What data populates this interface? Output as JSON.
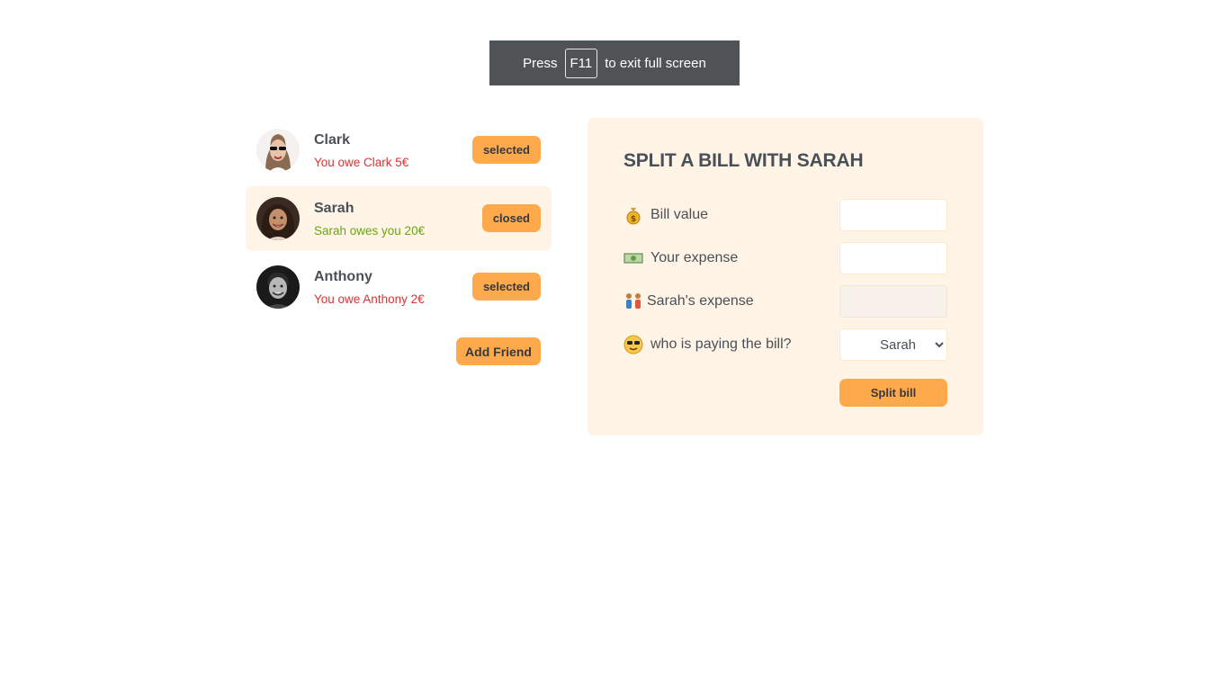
{
  "toast": {
    "press": "Press",
    "key": "F11",
    "suffix": "to exit full screen"
  },
  "friends": [
    {
      "name": "Clark",
      "balance": "You owe Clark 5€",
      "status": "red",
      "button": "selected"
    },
    {
      "name": "Sarah",
      "balance": "Sarah owes you 20€",
      "status": "green",
      "button": "closed"
    },
    {
      "name": "Anthony",
      "balance": "You owe Anthony 2€",
      "status": "red",
      "button": "selected"
    }
  ],
  "add_friend_label": "Add Friend",
  "form": {
    "title": "SPLIT A BILL WITH SARAH",
    "bill_label": "Bill value",
    "bill_icon": "money-bag-icon",
    "expense_label": "Your expense",
    "expense_icon": "dollar-bill-icon",
    "friend_expense_label": "Sarah's expense",
    "friend_expense_icon": "couple-icon",
    "payer_label": "who is paying the bill?",
    "payer_icon": "sunglasses-face-icon",
    "payer_selected": "Sarah",
    "split_label": "Split bill"
  },
  "colors": {
    "accent": "#ffa94d",
    "panel": "#fff4e6",
    "owe": "#e03131",
    "owed": "#66a80f"
  }
}
